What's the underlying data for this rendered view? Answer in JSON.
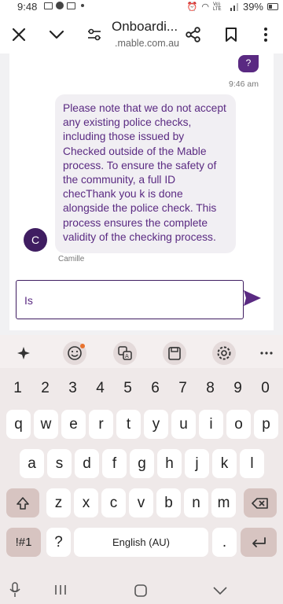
{
  "status_bar": {
    "time": "9:48",
    "network": "Vo) LTE",
    "battery": "39%"
  },
  "browser": {
    "title": "Onboardi...",
    "url": ".mable.com.au"
  },
  "chat": {
    "user_message": "?",
    "user_time": "9:46 am",
    "agent_message": "Please note that we do not accept any existing police checks, including those issued by Checked outside of the Mable process. To ensure the safety of the community, a full ID checThank you k is done alongside the police check. This process ensures the complete validity of the checking process.",
    "agent_initial": "C",
    "agent_name": "Camille",
    "input_value": "Is"
  },
  "keyboard": {
    "tools": [
      "sparkle-icon",
      "emoji-icon",
      "translate-icon",
      "clipboard-icon",
      "settings-icon",
      "more-icon"
    ],
    "numbers": [
      "1",
      "2",
      "3",
      "4",
      "5",
      "6",
      "7",
      "8",
      "9",
      "0"
    ],
    "row1": [
      "q",
      "w",
      "e",
      "r",
      "t",
      "y",
      "u",
      "i",
      "o",
      "p"
    ],
    "row2": [
      "a",
      "s",
      "d",
      "f",
      "g",
      "h",
      "j",
      "k",
      "l"
    ],
    "row3": [
      "z",
      "x",
      "c",
      "v",
      "b",
      "n",
      "m"
    ],
    "symbols_key": "!#1",
    "question_key": "?",
    "space_label": "English (AU)",
    "period_key": "."
  }
}
